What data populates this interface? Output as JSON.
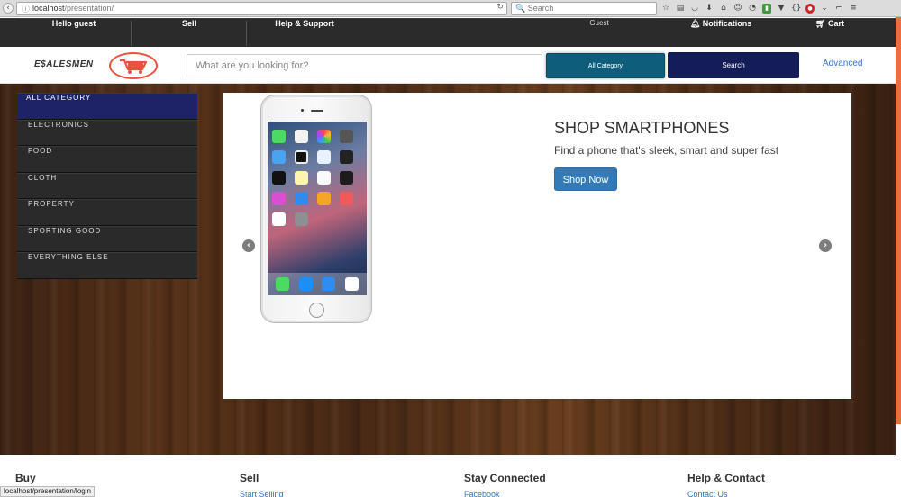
{
  "browser": {
    "url_host": "localhost",
    "url_path": "/presentation/",
    "search_placeholder": "Search",
    "reload_icon": "reload-icon",
    "info_icon": "info-icon"
  },
  "topnav": {
    "greeting": "Hello guest",
    "sell": "Sell",
    "help": "Help & Support",
    "guest": "Guest",
    "notifications": "Notifications",
    "cart": "Cart"
  },
  "header": {
    "logo_text": "E$ALESMEN",
    "search_placeholder": "What are you looking for?",
    "category_button": "All Category",
    "search_button": "Search",
    "advanced": "Advanced"
  },
  "sidebar": {
    "items": [
      {
        "label": "All Category"
      },
      {
        "label": "Electronics"
      },
      {
        "label": "Food"
      },
      {
        "label": "Cloth"
      },
      {
        "label": "Property"
      },
      {
        "label": "Sporting Good"
      },
      {
        "label": "Everything Else"
      }
    ]
  },
  "carousel": {
    "title": "SHOP SMARTPHONES",
    "subtitle": "Find a phone that's sleek, smart and super fast",
    "button": "Shop Now",
    "prev_icon": "chevron-left-icon",
    "next_icon": "chevron-right-icon"
  },
  "footer": {
    "columns": [
      {
        "heading": "Buy",
        "link": ""
      },
      {
        "heading": "Sell",
        "link": "Start Selling"
      },
      {
        "heading": "Stay Connected",
        "link": "Facebook"
      },
      {
        "heading": "Help & Contact",
        "link": "Contact Us"
      }
    ]
  },
  "status_bar_url": "localhost/presentation/login",
  "colors": {
    "topnav_bg": "#2b2b2b",
    "active_category": "#1d2366",
    "category_button": "#0e5d7a",
    "search_button": "#141d57",
    "shop_button": "#337ab7",
    "link": "#3572c6"
  }
}
